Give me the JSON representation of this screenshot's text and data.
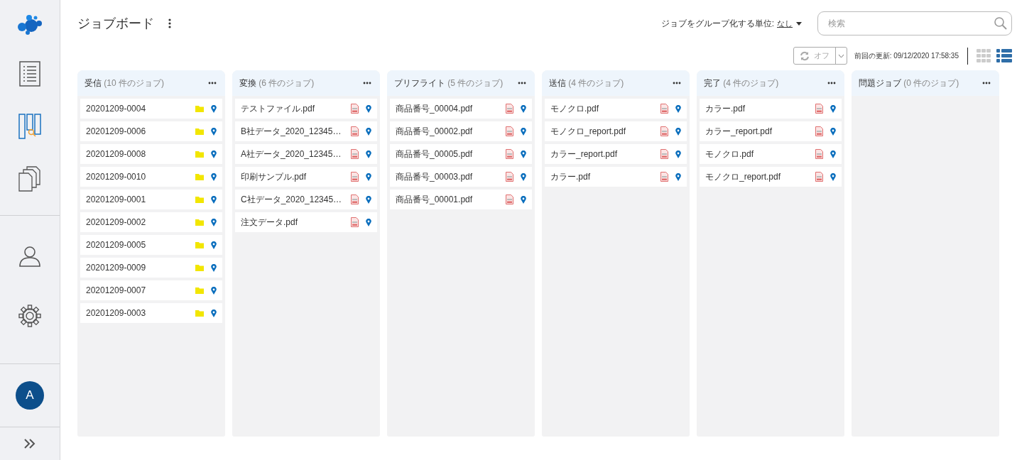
{
  "sidebar": {
    "nav_top": [
      {
        "kind": "list",
        "selected": false
      },
      {
        "kind": "board",
        "selected": true
      },
      {
        "kind": "documents",
        "selected": false
      }
    ],
    "nav_bottom": [
      {
        "kind": "user",
        "selected": false
      },
      {
        "kind": "settings",
        "selected": false
      }
    ],
    "avatar": "A"
  },
  "header": {
    "title": "ジョブボード",
    "group_by": {
      "label": "ジョブをグループ化する単位:",
      "value": "なし"
    },
    "search": {
      "placeholder": "検索"
    },
    "refresh": {
      "label": "オフ",
      "on": false
    },
    "last_update": "前回の更新: 09/12/2020 17:58:35",
    "views": [
      {
        "kind": "grid",
        "selected": false
      },
      {
        "kind": "list",
        "selected": true
      }
    ]
  },
  "columns": [
    {
      "name": "受信",
      "count": "(10 件のジョブ)",
      "jobs": [
        {
          "name": "20201209-0004",
          "kind": "folder"
        },
        {
          "name": "20201209-0006",
          "kind": "folder"
        },
        {
          "name": "20201209-0008",
          "kind": "folder"
        },
        {
          "name": "20201209-0010",
          "kind": "folder"
        },
        {
          "name": "20201209-0001",
          "kind": "folder"
        },
        {
          "name": "20201209-0002",
          "kind": "folder"
        },
        {
          "name": "20201209-0005",
          "kind": "folder"
        },
        {
          "name": "20201209-0009",
          "kind": "folder"
        },
        {
          "name": "20201209-0007",
          "kind": "folder"
        },
        {
          "name": "20201209-0003",
          "kind": "folder"
        }
      ]
    },
    {
      "name": "変換",
      "count": "(6 件のジョブ)",
      "jobs": [
        {
          "name": "テストファイル.pdf",
          "kind": "pdf"
        },
        {
          "name": "B社データ_2020_12345…",
          "kind": "pdf"
        },
        {
          "name": "A社データ_2020_12345…",
          "kind": "pdf"
        },
        {
          "name": "印刷サンプル.pdf",
          "kind": "pdf"
        },
        {
          "name": "C社データ_2020_12345…",
          "kind": "pdf"
        },
        {
          "name": "注文データ.pdf",
          "kind": "pdf"
        }
      ]
    },
    {
      "name": "プリフライト",
      "count": "(5 件のジョブ)",
      "jobs": [
        {
          "name": "商品番号_00004.pdf",
          "kind": "pdf"
        },
        {
          "name": "商品番号_00002.pdf",
          "kind": "pdf"
        },
        {
          "name": "商品番号_00005.pdf",
          "kind": "pdf"
        },
        {
          "name": "商品番号_00003.pdf",
          "kind": "pdf"
        },
        {
          "name": "商品番号_00001.pdf",
          "kind": "pdf"
        }
      ]
    },
    {
      "name": "送信",
      "count": "(4 件のジョブ)",
      "jobs": [
        {
          "name": "モノクロ.pdf",
          "kind": "pdf"
        },
        {
          "name": "モノクロ_report.pdf",
          "kind": "pdf"
        },
        {
          "name": "カラー_report.pdf",
          "kind": "pdf"
        },
        {
          "name": "カラー.pdf",
          "kind": "pdf"
        }
      ]
    },
    {
      "name": "完了",
      "count": "(4 件のジョブ)",
      "jobs": [
        {
          "name": "カラー.pdf",
          "kind": "pdf"
        },
        {
          "name": "カラー_report.pdf",
          "kind": "pdf"
        },
        {
          "name": "モノクロ.pdf",
          "kind": "pdf"
        },
        {
          "name": "モノクロ_report.pdf",
          "kind": "pdf"
        }
      ]
    },
    {
      "name": "問題ジョブ",
      "count": "(0 件のジョブ)"
    }
  ]
}
